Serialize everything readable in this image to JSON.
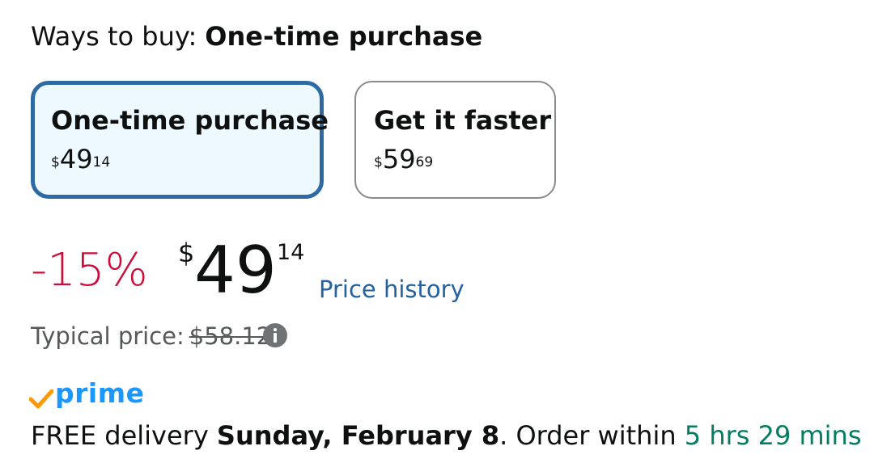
{
  "ways_to_buy": {
    "label": "Ways to buy:",
    "selected": "One-time purchase"
  },
  "options": [
    {
      "title": "One-time purchase",
      "price_symbol": "$",
      "price_whole": "49",
      "price_cents": "14",
      "selected": true
    },
    {
      "title": "Get it faster",
      "price_symbol": "$",
      "price_whole": "59",
      "price_cents": "69",
      "selected": false
    }
  ],
  "price": {
    "discount": "-15%",
    "symbol": "$",
    "whole": "49",
    "cents": "14",
    "history_link": "Price history"
  },
  "typical_price": {
    "label": "Typical price:",
    "value": "$58.12",
    "info_icon": "info-icon"
  },
  "prime": {
    "logo_text": "prime",
    "check_icon": "prime-check-icon"
  },
  "delivery": {
    "prefix": "FREE delivery ",
    "date": "Sunday, February 8",
    "middle": ". Order within ",
    "countdown": "5 hrs 29 mins"
  },
  "colors": {
    "discount": "#cc0c39",
    "link": "#2162a1",
    "selected_border": "#2d6aa4",
    "selected_bg": "#edf8ff",
    "prime_blue": "#1a98ff",
    "prime_check": "#ff9900",
    "countdown": "#067d62"
  }
}
